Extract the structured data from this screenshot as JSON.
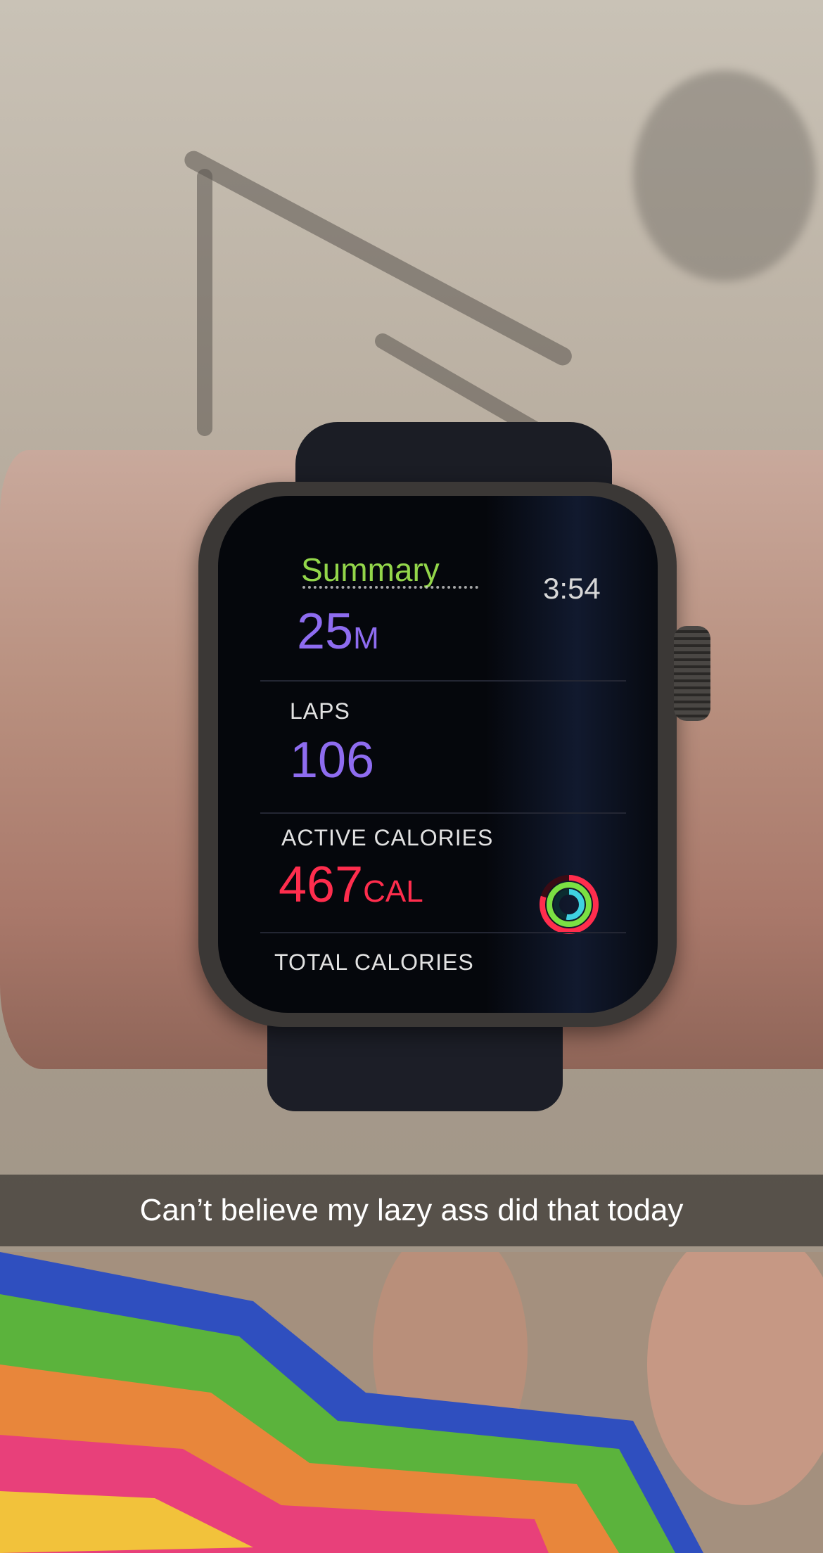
{
  "watch": {
    "app_title": "Summary",
    "time": "3:54",
    "metrics": [
      {
        "label": "",
        "value": "25",
        "unit": "M",
        "color": "#8e6cf0"
      },
      {
        "label": "LAPS",
        "value": "106",
        "unit": "",
        "color": "#8e6cf0"
      },
      {
        "label": "ACTIVE CALORIES",
        "value": "467",
        "unit": "CAL",
        "color": "#ff2d4d"
      },
      {
        "label": "TOTAL CALORIES",
        "value": "",
        "unit": ""
      }
    ],
    "accent_colors": {
      "title": "#93d64a",
      "rings_move": "#ff2d4d",
      "rings_exercise": "#7be043",
      "rings_stand": "#3fd2e0"
    }
  },
  "caption": {
    "text": "Can’t believe my lazy ass did that today"
  }
}
